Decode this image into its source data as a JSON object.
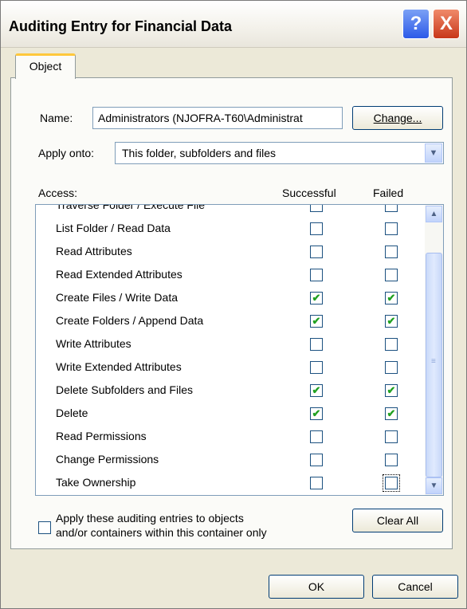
{
  "window": {
    "title": "Auditing Entry for Financial Data"
  },
  "titlebar": {
    "help_label": "?",
    "close_label": "X"
  },
  "tabs": [
    {
      "label": "Object"
    }
  ],
  "name_field": {
    "label": "Name:",
    "value": "Administrators (NJOFRA-T60\\Administrat",
    "change_button": "Change..."
  },
  "apply_onto": {
    "label": "Apply onto:",
    "value": "This folder, subfolders and files"
  },
  "access": {
    "header": {
      "access_label": "Access:",
      "successful_label": "Successful",
      "failed_label": "Failed"
    },
    "rows": [
      {
        "name": "Traverse Folder / Execute File",
        "successful": false,
        "failed": false
      },
      {
        "name": "List Folder / Read Data",
        "successful": false,
        "failed": false
      },
      {
        "name": "Read Attributes",
        "successful": false,
        "failed": false
      },
      {
        "name": "Read Extended Attributes",
        "successful": false,
        "failed": false
      },
      {
        "name": "Create Files / Write Data",
        "successful": true,
        "failed": true
      },
      {
        "name": "Create Folders / Append Data",
        "successful": true,
        "failed": true
      },
      {
        "name": "Write Attributes",
        "successful": false,
        "failed": false
      },
      {
        "name": "Write Extended Attributes",
        "successful": false,
        "failed": false
      },
      {
        "name": "Delete Subfolders and Files",
        "successful": true,
        "failed": true
      },
      {
        "name": "Delete",
        "successful": true,
        "failed": true
      },
      {
        "name": "Read Permissions",
        "successful": false,
        "failed": false
      },
      {
        "name": "Change Permissions",
        "successful": false,
        "failed": false
      },
      {
        "name": "Take Ownership",
        "successful": false,
        "failed": false
      }
    ]
  },
  "apply_inherit": {
    "label_line1": "Apply these auditing entries to objects",
    "label_line2": "and/or containers within this container only",
    "checked": false
  },
  "buttons": {
    "clear_all": "Clear All",
    "ok": "OK",
    "cancel": "Cancel"
  },
  "icons": {
    "checkmark": "✔",
    "dropdown": "chevron-down-icon"
  },
  "colors": {
    "check_green": "#21a121",
    "button_border": "#003c74",
    "tab_highlight": "#ffc83c"
  }
}
